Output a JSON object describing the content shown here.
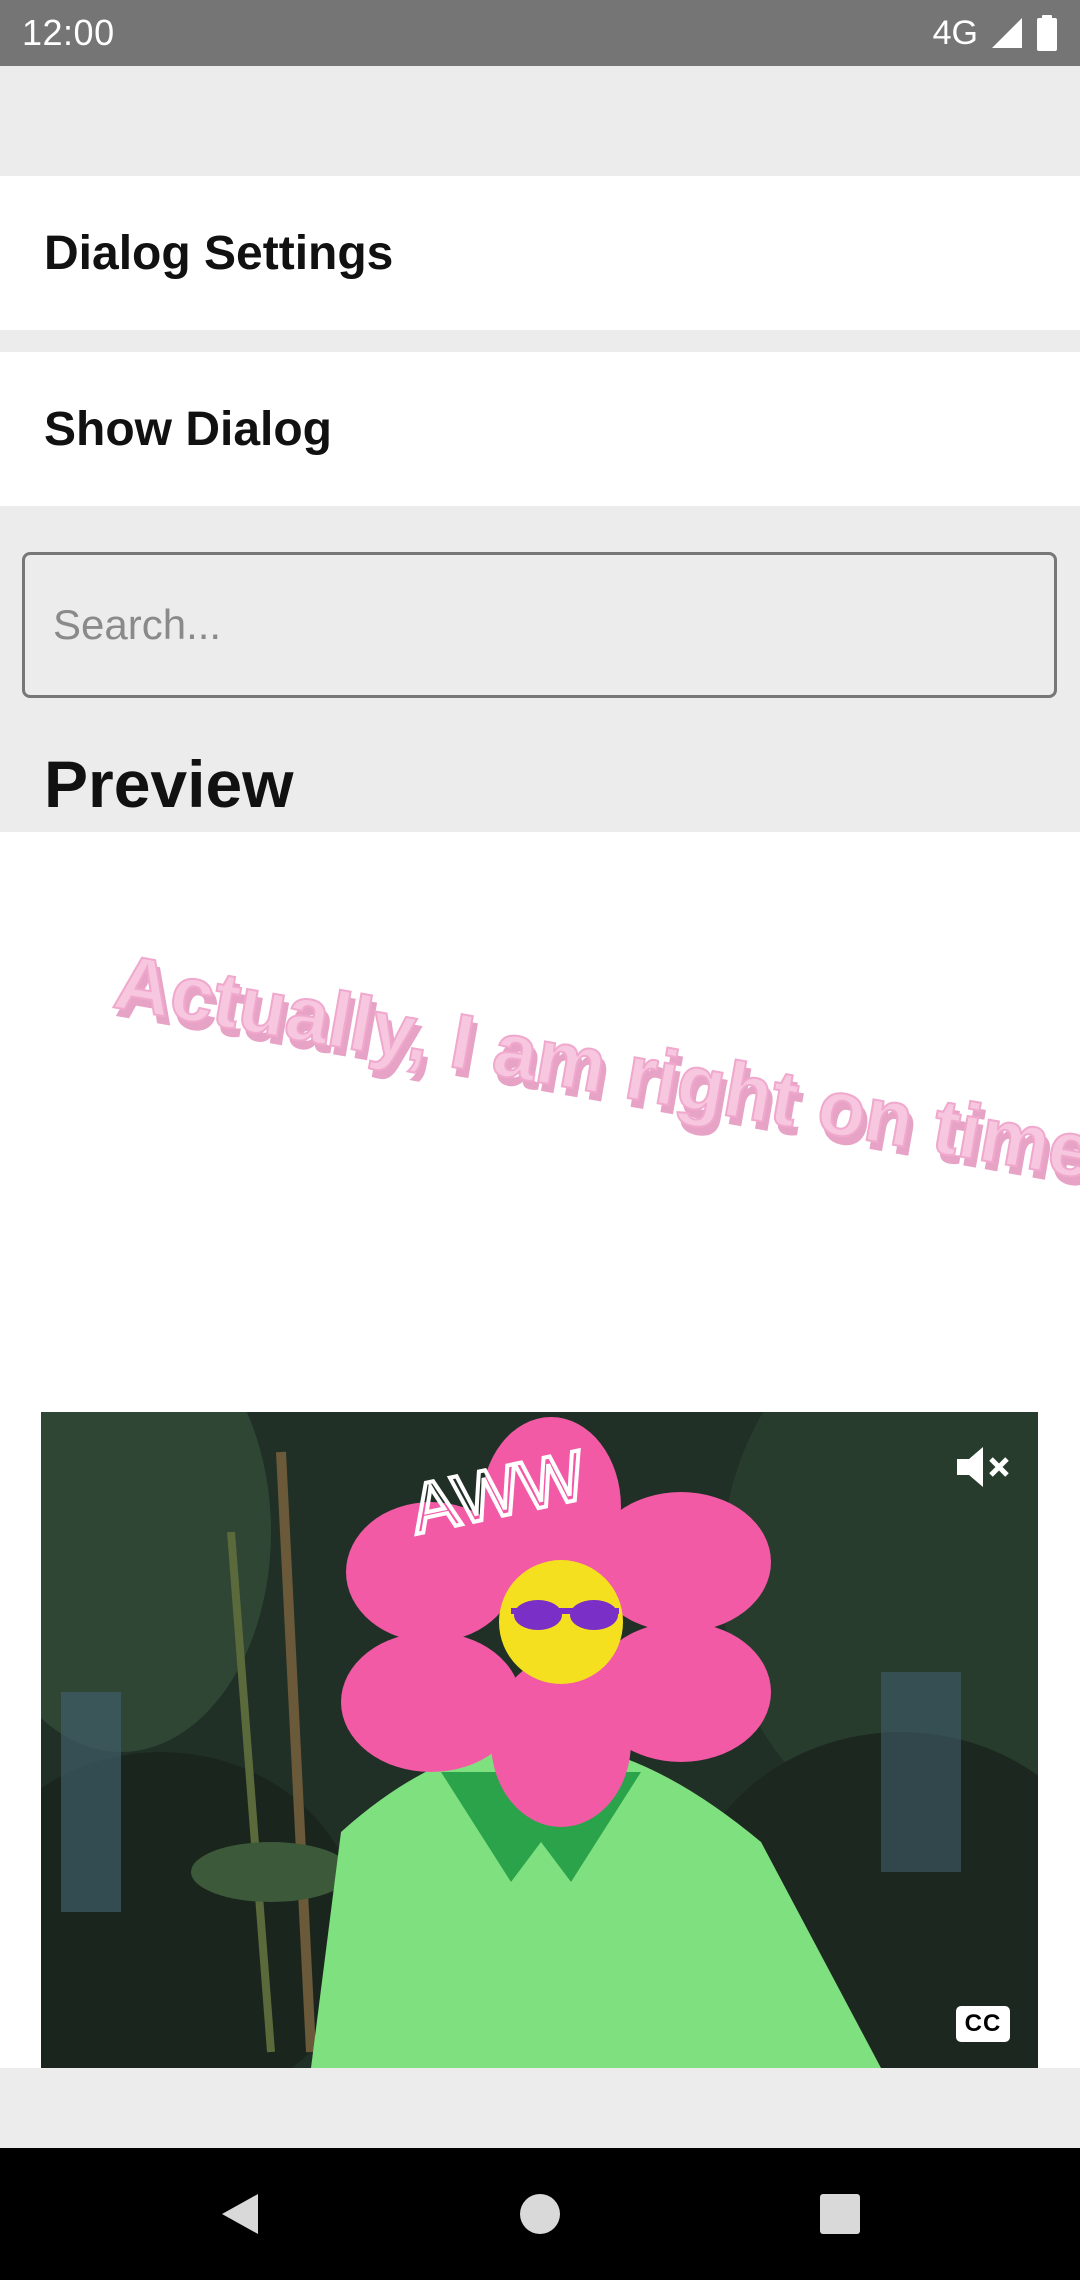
{
  "status_bar": {
    "time": "12:00",
    "network": "4G",
    "icons": [
      "signal-icon",
      "battery-icon"
    ]
  },
  "settings_list": {
    "dialog_settings_label": "Dialog Settings",
    "show_dialog_label": "Show Dialog"
  },
  "search": {
    "placeholder": "Search...",
    "value": ""
  },
  "preview": {
    "title": "Preview",
    "sticker_text": "Actually, I am right on time",
    "video_caption_text": "AWW",
    "video_controls": {
      "mute_icon": "volume-mute-icon",
      "cc_label": "CC"
    }
  },
  "nav_bar": {
    "icons": [
      "back-icon",
      "home-icon",
      "recents-icon"
    ]
  },
  "colors": {
    "status_bar": "#757575",
    "background": "#ececec",
    "sticker_pink": "#f4b6d6",
    "nav_bar": "#000000"
  }
}
